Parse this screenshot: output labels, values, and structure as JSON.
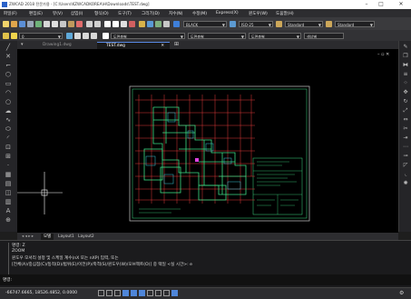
{
  "window": {
    "title": "ZWCAD 2018 전문가용 - [C:\\Users\\KZWCADKOREA\\H\\Downloads\\TEST.dwg]",
    "minimize_glyph": "–",
    "maximize_glyph": "□",
    "close_glyph": "✕"
  },
  "menu": {
    "items": [
      "파일(F)",
      "편집(E)",
      "뷰(V)",
      "삽입(I)",
      "형식(O)",
      "도구(T)",
      "그리기(D)",
      "치수(N)",
      "수정(M)",
      "Express(X)",
      "윈도우(W)",
      "도움말(H)"
    ]
  },
  "toolbar": {
    "color_combo": "BLACK",
    "linetype_combo": "ISO-25",
    "textstyle_combo": "Standard",
    "dimstyle_combo": "Standard",
    "layer_combo": "0",
    "linetype2_combo": "도면층별",
    "lineweight_combo": "도면층별",
    "plotstyle_combo": "도면층별",
    "color2_combo": "색상별"
  },
  "tabs": {
    "drawing_tab": "Drawing1.dwg",
    "test_tab": "TEST.dwg",
    "test_close": "✕",
    "add_tab": "⊞"
  },
  "canvas": {
    "view_controls": "– ▫ ✕"
  },
  "layout_tabs": {
    "model": "모델",
    "layout1": "Layout1",
    "layout2": "Layout2"
  },
  "command": {
    "line1": "명령: Z",
    "line2": "ZOOM",
    "line3": "윈도우 모서리 설정 및 스케일 계수(nX 또는 nXP) 입력, 또는",
    "line4": "[전체(A)/중심점(C)/동적(D)/범위(E)/이전(P)/축척(S)/윈도우(W)/오브젝트(O)] 중 택일 <실 시간>: e",
    "prompt": "명령:"
  },
  "status": {
    "coords": "-66747.6665, 18526.4852, 0.0000"
  },
  "colors": {
    "canvas_bg": "#000000",
    "drawing_red": "#e03a3a",
    "drawing_green": "#3ddc84",
    "drawing_cyan": "#38c7d8",
    "accent_blue": "#5a8be6"
  }
}
